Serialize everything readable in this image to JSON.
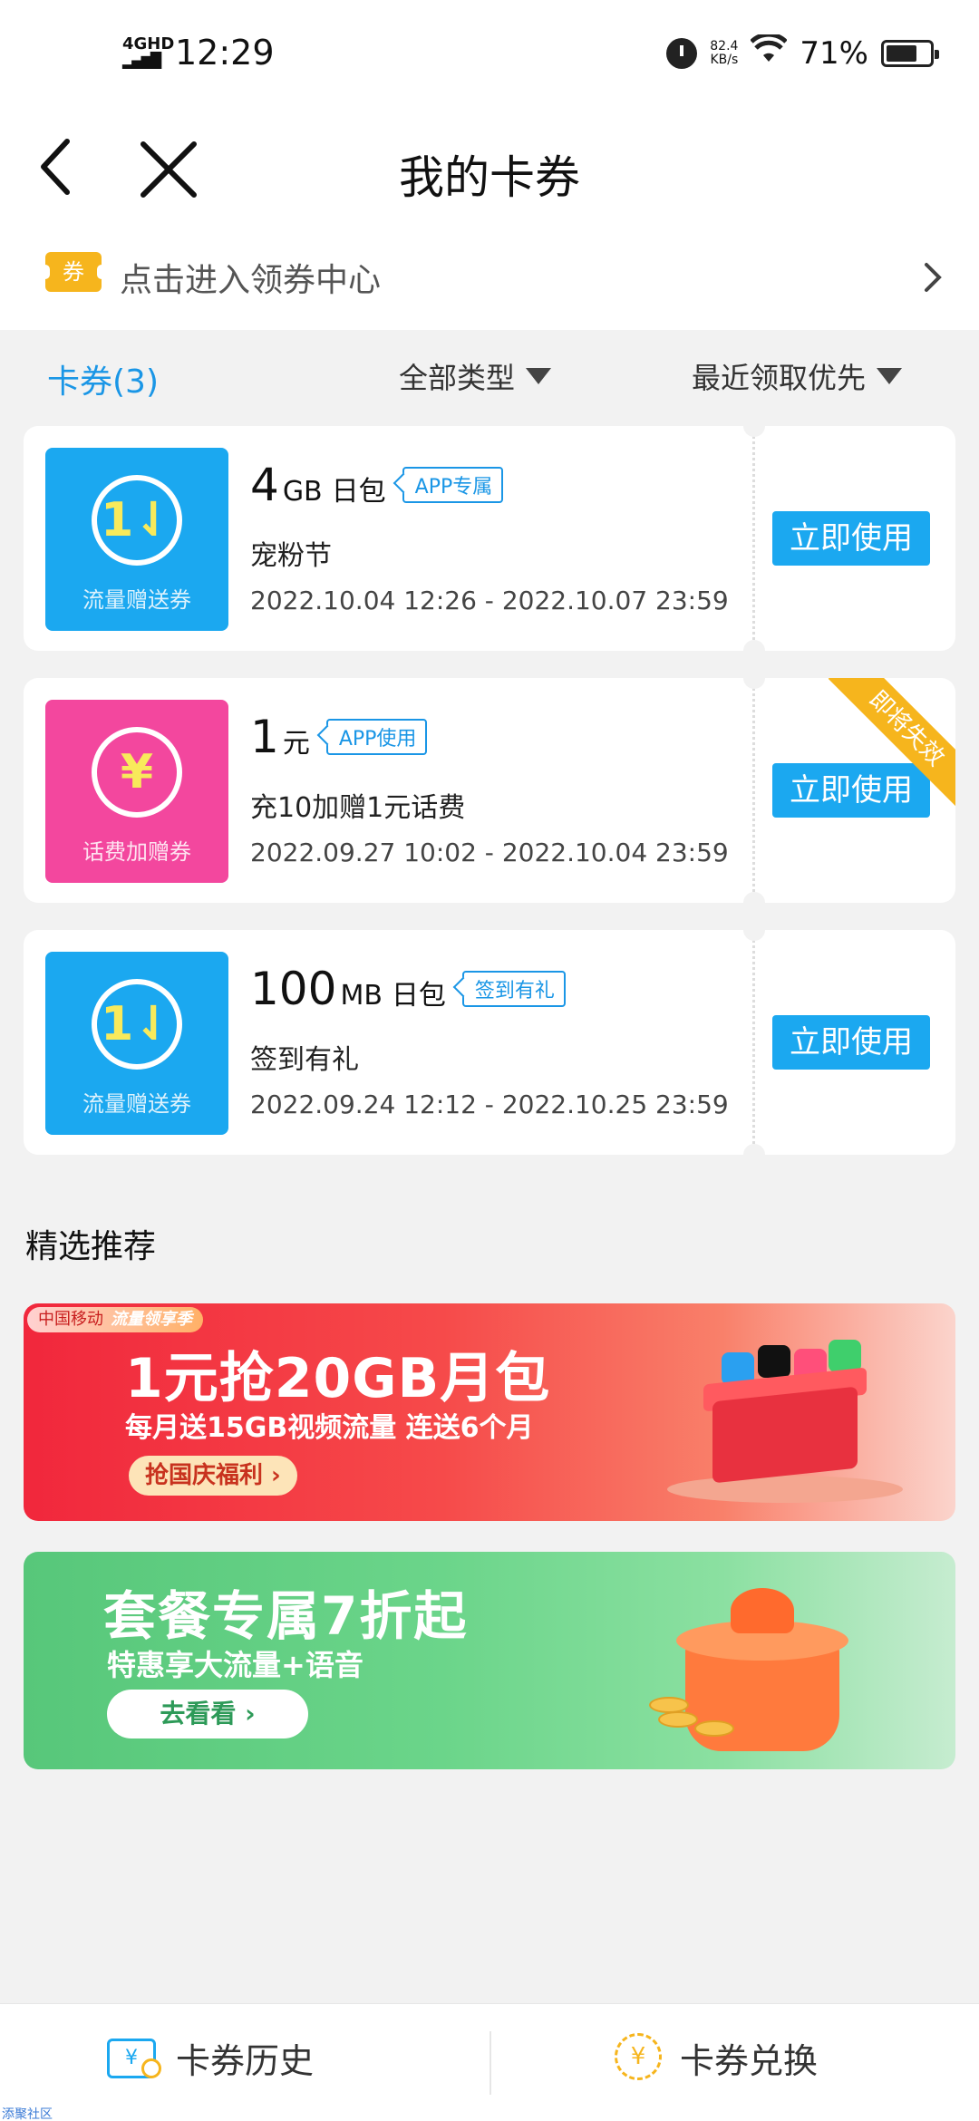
{
  "status_bar": {
    "network": "4GHD",
    "time": "12:29",
    "speed_value": "82.4",
    "speed_unit": "KB/s",
    "battery": "71%",
    "battery_level": 0.71
  },
  "header": {
    "title": "我的卡券"
  },
  "coupon_center": {
    "badge": "券",
    "label": "点击进入领券中心"
  },
  "filters": {
    "count_tab": "卡券(3)",
    "type_filter": "全部类型",
    "sort_filter": "最近领取优先"
  },
  "coupons": [
    {
      "icon_label": "流量赠送券",
      "amount": "4",
      "unit": "GB",
      "kind": "日包",
      "tag": "APP专属",
      "desc": "宠粉节",
      "date_range": "2022.10.04 12:26 - 2022.10.07 23:59",
      "button": "立即使用"
    },
    {
      "icon_label": "话费加赠券",
      "amount": "1",
      "unit": "元",
      "kind": "",
      "tag": "APP使用",
      "desc": "充10加赠1元话费",
      "date_range": "2022.09.27 10:02 - 2022.10.04 23:59",
      "button": "立即使用",
      "ribbon": "即将失效"
    },
    {
      "icon_label": "流量赠送券",
      "amount": "100",
      "unit": "MB",
      "kind": "日包",
      "tag": "签到有礼",
      "desc": "签到有礼",
      "date_range": "2022.09.24 12:12 - 2022.10.25 23:59",
      "button": "立即使用"
    }
  ],
  "recommend": {
    "title": "精选推荐",
    "banner1": {
      "badge": "中国移动",
      "tagline": "流量领享季",
      "headline": "1元抢20GB月包",
      "subline": "每月送15GB视频流量 连送6个月",
      "button": "抢国庆福利 ›"
    },
    "banner2": {
      "headline": "套餐专属7折起",
      "subline": "特惠享大流量+语音",
      "button": "去看看 ›"
    }
  },
  "bottom_bar": {
    "history": "卡券历史",
    "exchange": "卡券兑换"
  },
  "watermark": "添聚社区",
  "colors": {
    "accent": "#1ba8f0",
    "pink": "#f3479e",
    "gold": "#f6b51d"
  }
}
